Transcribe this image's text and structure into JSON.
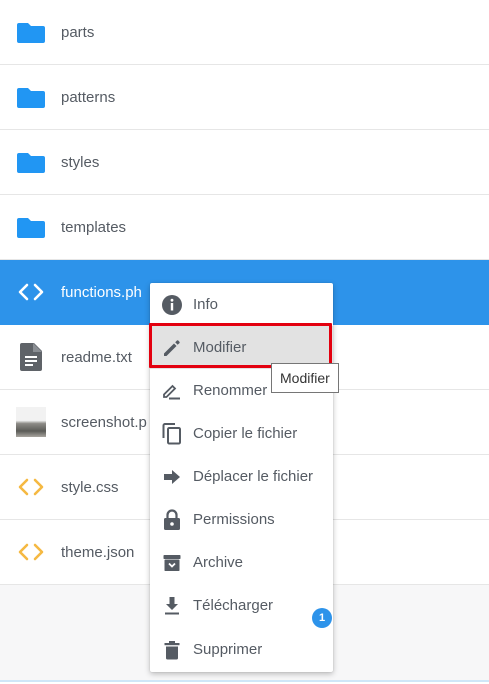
{
  "files": [
    {
      "name": "parts",
      "icon": "folder-icon"
    },
    {
      "name": "patterns",
      "icon": "folder-icon"
    },
    {
      "name": "styles",
      "icon": "folder-icon"
    },
    {
      "name": "templates",
      "icon": "folder-icon"
    },
    {
      "name": "functions.ph",
      "icon": "code-icon",
      "selected": true
    },
    {
      "name": "readme.txt",
      "icon": "text-file-icon"
    },
    {
      "name": "screenshot.p",
      "icon": "image-thumbnail"
    },
    {
      "name": "style.css",
      "icon": "code-icon"
    },
    {
      "name": "theme.json",
      "icon": "code-icon"
    }
  ],
  "context_menu": {
    "items": [
      {
        "label": "Info",
        "icon": "info-icon"
      },
      {
        "label": "Modifier",
        "icon": "pencil-icon",
        "highlighted": true
      },
      {
        "label": "Renommer",
        "icon": "rename-icon"
      },
      {
        "label": "Copier le fichier",
        "icon": "copy-icon"
      },
      {
        "label": "Déplacer le fichier",
        "icon": "arrow-right-icon"
      },
      {
        "label": "Permissions",
        "icon": "lock-icon"
      },
      {
        "label": "Archive",
        "icon": "archive-icon"
      },
      {
        "label": "Télécharger",
        "icon": "download-icon"
      },
      {
        "label": "Supprimer",
        "icon": "trash-icon"
      }
    ]
  },
  "tooltip": {
    "text": "Modifier"
  },
  "notification_badge": {
    "count": "1"
  },
  "colors": {
    "accent": "#2d93ea",
    "folder": "#2196f3",
    "code_icon_default": "#f5b942",
    "menu_icon": "#555b63",
    "highlight_border": "#e3000f"
  }
}
